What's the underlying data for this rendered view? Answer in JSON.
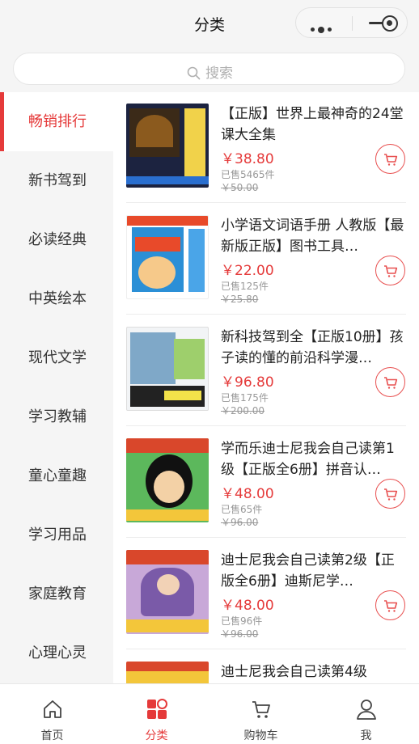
{
  "header": {
    "title": "分类"
  },
  "search": {
    "placeholder": "搜索"
  },
  "categories": [
    {
      "label": "畅销排行",
      "active": true
    },
    {
      "label": "新书驾到",
      "active": false
    },
    {
      "label": "必读经典",
      "active": false
    },
    {
      "label": "中英绘本",
      "active": false
    },
    {
      "label": "现代文学",
      "active": false
    },
    {
      "label": "学习教辅",
      "active": false
    },
    {
      "label": "童心童趣",
      "active": false
    },
    {
      "label": "学习用品",
      "active": false
    },
    {
      "label": "家庭教育",
      "active": false
    },
    {
      "label": "心理心灵",
      "active": false
    }
  ],
  "products": [
    {
      "title": "【正版】世界上最神奇的24堂课大全集",
      "price": "￥38.80",
      "sold": "已售5465件",
      "original": "￥50.00"
    },
    {
      "title": "小学语文词语手册 人教版【最新版正版】图书工具…",
      "price": "￥22.00",
      "sold": "已售125件",
      "original": "￥25.80"
    },
    {
      "title": "新科技驾到全【正版10册】孩子读的懂的前沿科学漫…",
      "price": "￥96.80",
      "sold": "已售175件",
      "original": "￥200.00"
    },
    {
      "title": "学而乐迪士尼我会自己读第1级【正版全6册】拼音认…",
      "price": "￥48.00",
      "sold": "已售65件",
      "original": "￥96.00"
    },
    {
      "title": "迪士尼我会自己读第2级【正版全6册】迪斯尼学…",
      "price": "￥48.00",
      "sold": "已售96件",
      "original": "￥96.00"
    },
    {
      "title": "迪士尼我会自己读第4级",
      "price": "",
      "sold": "",
      "original": ""
    }
  ],
  "tabs": [
    {
      "label": "首页",
      "icon": "home-icon"
    },
    {
      "label": "分类",
      "icon": "category-icon"
    },
    {
      "label": "购物车",
      "icon": "cart-icon"
    },
    {
      "label": "我",
      "icon": "user-icon"
    }
  ],
  "colors": {
    "accent": "#e53a3a",
    "background": "#f5f5f5"
  }
}
